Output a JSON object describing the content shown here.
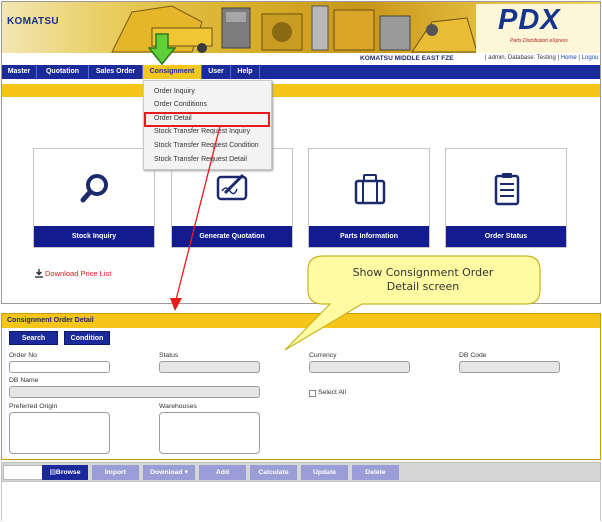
{
  "header": {
    "brand_logo": "KOMATSU",
    "pdx_logo": "PDX",
    "pdx_tagline": "Parts Distribution eXpress",
    "company_name": "KOMATSU MIDDLE EAST FZE",
    "user_info": "| admin, Database: Testing |",
    "home_link": "Home",
    "logout_link": "Logou"
  },
  "menu": {
    "items": [
      {
        "label": "Master"
      },
      {
        "label": "Quotation"
      },
      {
        "label": "Sales Order"
      },
      {
        "label": "Consignment"
      },
      {
        "label": "User"
      },
      {
        "label": "Help"
      }
    ]
  },
  "dropdown": {
    "items": [
      {
        "label": "Order Inquiry"
      },
      {
        "label": "Order Conditions"
      },
      {
        "label": "Order Detail"
      },
      {
        "label": "Stock Transfer Request Inquiry"
      },
      {
        "label": "Stock Transfer Request Condition"
      },
      {
        "label": "Stock Transfer Request Detail"
      }
    ],
    "highlighted": "Order Detail"
  },
  "tiles": [
    {
      "label": "Stock Inquiry",
      "icon": "magnifier-icon"
    },
    {
      "label": "Generate Quotation",
      "icon": "tablet-pen-icon"
    },
    {
      "label": "Parts Information",
      "icon": "luggage-icon"
    },
    {
      "label": "Order Status",
      "icon": "clipboard-icon"
    }
  ],
  "download_link": "Download Price List",
  "callout": {
    "line1": "Show Consignment  Order",
    "line2": "Detail screen"
  },
  "panel": {
    "title": "Consignment Order Detail",
    "search_button": "Search",
    "condition_button": "Condition",
    "labels": {
      "order_no": "Order No",
      "status": "Status",
      "currency": "Currency",
      "db_code": "DB Code",
      "db_name": "DB Name",
      "select_all": "Select All",
      "preferred_origin": "Preferred Origin",
      "warehouses": "Warehouses"
    }
  },
  "actions": {
    "browse": "Browse",
    "import": "Import",
    "download": "Download",
    "add": "Add",
    "calculate": "Calculate",
    "update": "Update",
    "delete": "Delete"
  },
  "colors": {
    "navy": "#1b2a9b",
    "yellow": "#f5c518",
    "red": "#e81c1c",
    "disabled_button": "#9a9dd6"
  }
}
